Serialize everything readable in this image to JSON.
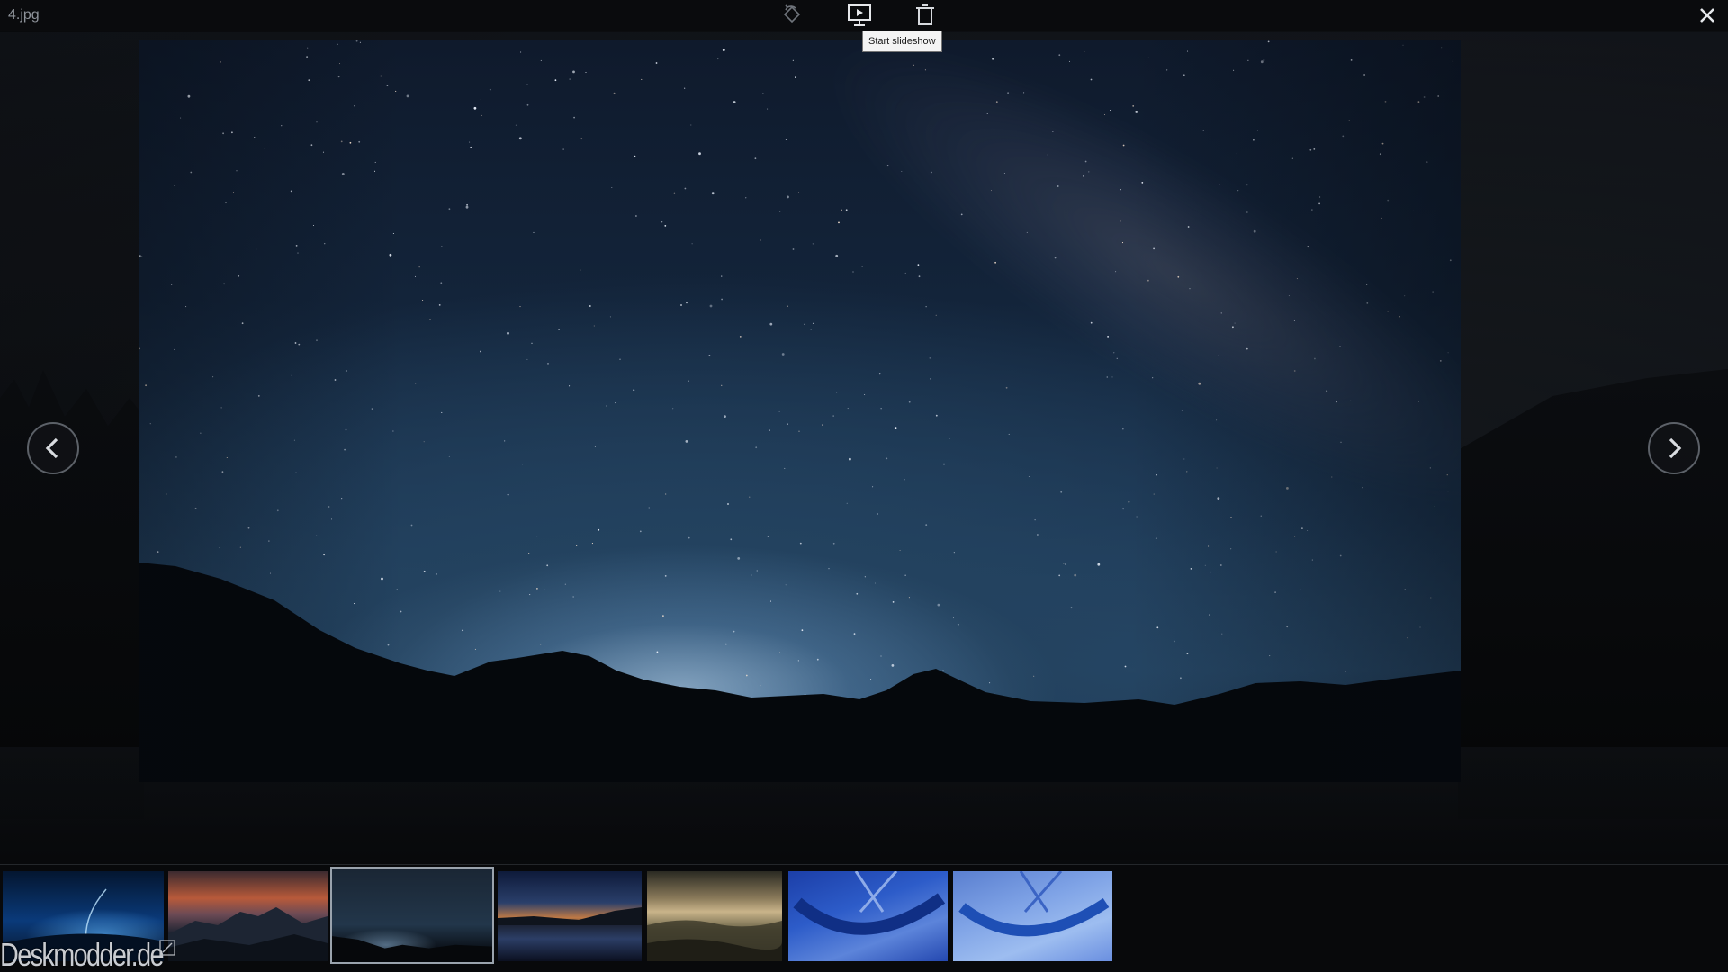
{
  "window": {
    "file_name": "4.jpg"
  },
  "toolbar": {
    "rotate_icon": "rotate-left-icon",
    "slideshow_icon": "slideshow-icon",
    "delete_icon": "delete-icon",
    "close_icon": "close-icon",
    "tooltip": "Start slideshow"
  },
  "navigation": {
    "prev_icon": "chevron-left-icon",
    "next_icon": "chevron-right-icon"
  },
  "filmstrip": {
    "thumbnails": [
      {
        "name": "thumbnail-1",
        "selected": false
      },
      {
        "name": "thumbnail-2",
        "selected": false
      },
      {
        "name": "thumbnail-3",
        "selected": true
      },
      {
        "name": "thumbnail-4",
        "selected": false
      },
      {
        "name": "thumbnail-5",
        "selected": false
      },
      {
        "name": "thumbnail-6",
        "selected": false
      },
      {
        "name": "thumbnail-7",
        "selected": false
      }
    ]
  },
  "watermark": {
    "text": "Deskmodder.de"
  },
  "colors": {
    "background": "#0b0d10",
    "tooltip_bg": "#f4f4f4",
    "icon": "#d7dade"
  }
}
